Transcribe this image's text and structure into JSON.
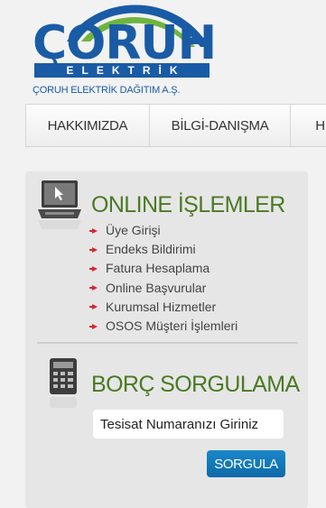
{
  "logo": {
    "word": "ÇORUH",
    "subword": "ELEKTRİK",
    "company": "ÇORUH ELEKTRİK DAĞITIM A.Ş.",
    "brand_blue": "#1a5ba6",
    "arc_green": "#6fb43f"
  },
  "nav": {
    "items": [
      {
        "label": "HAKKIMIZDA"
      },
      {
        "label": "BİLGİ-DANIŞMA"
      },
      {
        "label": "H"
      }
    ]
  },
  "online": {
    "title": "ONLINE İŞLEMLER",
    "icon": "laptop-cursor-icon",
    "items": [
      {
        "label": "Üye Girişi"
      },
      {
        "label": "Endeks Bildirimi"
      },
      {
        "label": "Fatura Hesaplama"
      },
      {
        "label": "Online Başvurular"
      },
      {
        "label": "Kurumsal Hizmetler"
      },
      {
        "label": "OSOS Müşteri İşlemleri"
      }
    ]
  },
  "borc": {
    "title": "BORÇ SORGULAMA",
    "icon": "calculator-icon",
    "input_placeholder": "Tesisat Numaranızı Giriniz",
    "button_label": "SORGULA"
  },
  "colors": {
    "title_green": "#4a7a23",
    "bullet_red": "#d7262e",
    "button_blue": "#1178bb"
  }
}
